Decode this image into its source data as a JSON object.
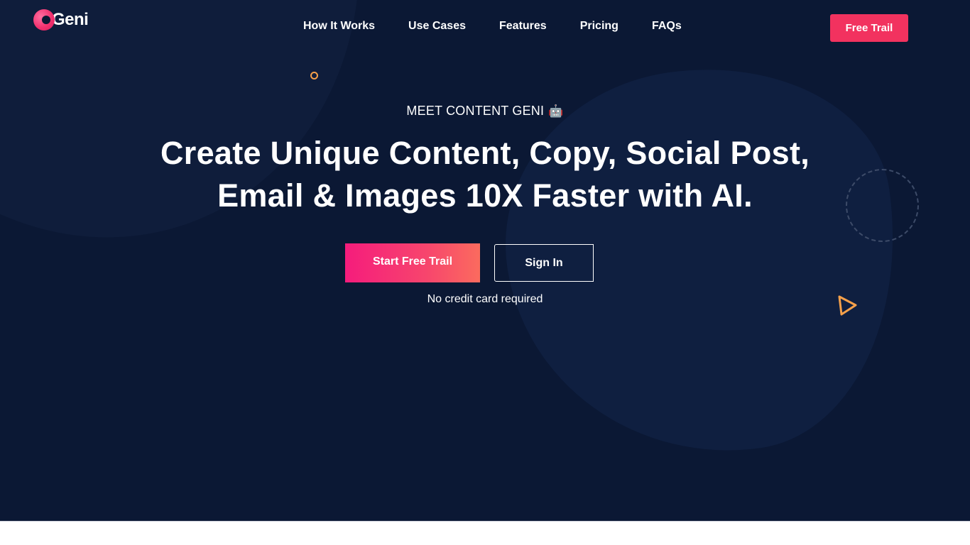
{
  "brand": {
    "name": "Geni",
    "logo_icon": "geni-logo-icon",
    "accent_color": "#f2325f",
    "background_color": "#0b1834"
  },
  "nav": {
    "items": [
      {
        "label": "How It Works"
      },
      {
        "label": "Use Cases"
      },
      {
        "label": "Features"
      },
      {
        "label": "Pricing"
      },
      {
        "label": "FAQs"
      }
    ]
  },
  "header": {
    "cta_label": "Free Trail"
  },
  "hero": {
    "eyebrow": "MEET CONTENT GENI",
    "eyebrow_icon": "🤖",
    "headline_line1": "Create Unique Content, Copy, Social Post,",
    "headline_line2": "Email & Images 10X Faster with AI.",
    "primary_cta": "Start Free Trail",
    "secondary_cta": "Sign In",
    "note": "No credit card required"
  }
}
